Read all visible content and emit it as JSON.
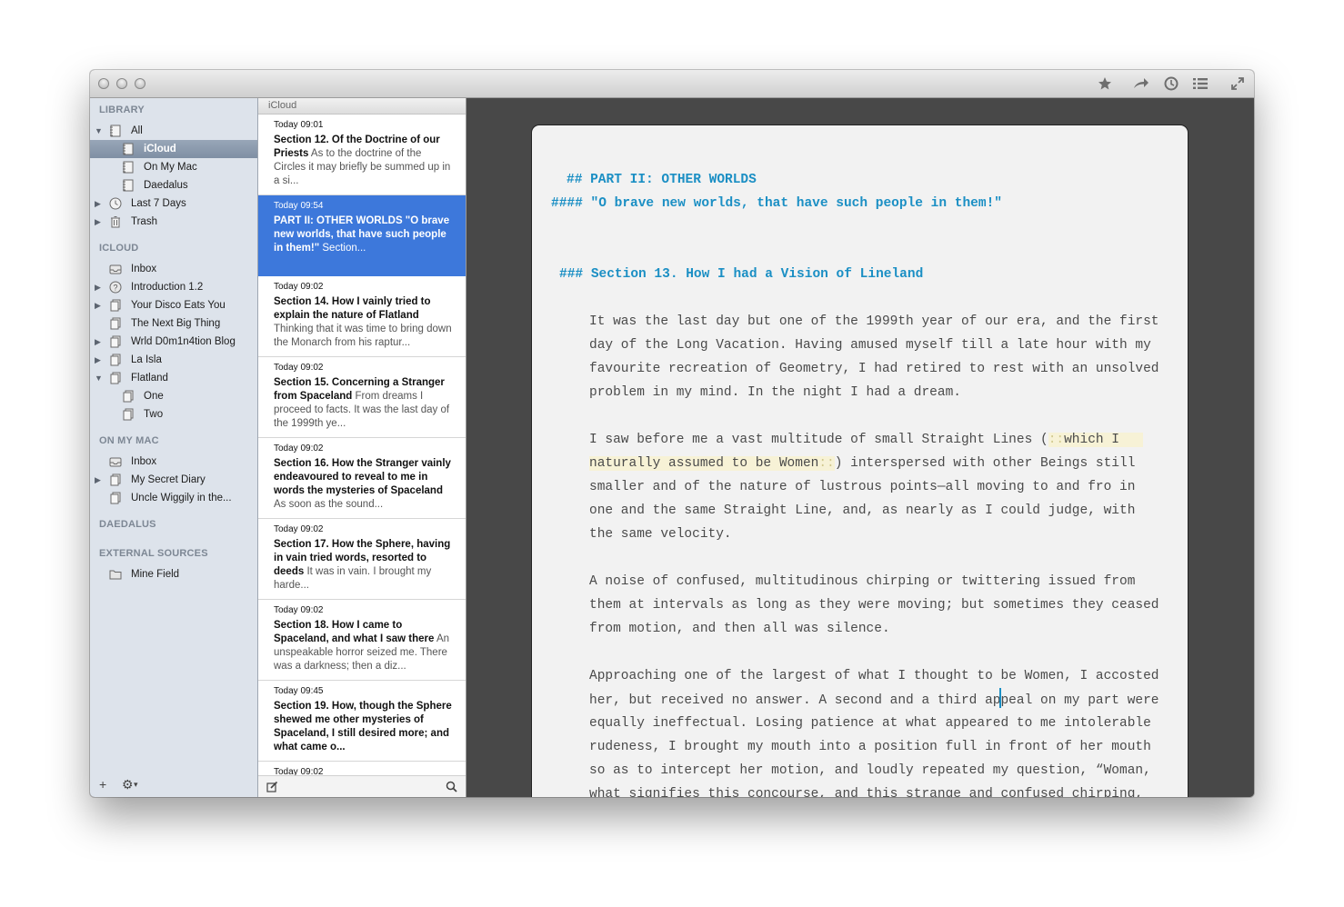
{
  "sidebar": {
    "library_header": "LIBRARY",
    "library": [
      {
        "label": "All",
        "disclosure": "open",
        "icon": "notebook-icon"
      },
      {
        "label": "iCloud",
        "icon": "notebook-icon",
        "selected": true
      },
      {
        "label": "On My Mac",
        "icon": "notebook-icon"
      },
      {
        "label": "Daedalus",
        "icon": "notebook-icon"
      },
      {
        "label": "Last 7 Days",
        "disclosure": "closed",
        "icon": "clock-icon"
      },
      {
        "label": "Trash",
        "disclosure": "closed",
        "icon": "trash-icon"
      }
    ],
    "icloud_header": "ICLOUD",
    "icloud": [
      {
        "label": "Inbox",
        "icon": "inbox-icon"
      },
      {
        "label": "Introduction 1.2",
        "disclosure": "closed",
        "icon": "help-icon"
      },
      {
        "label": "Your Disco Eats You",
        "disclosure": "closed",
        "icon": "stack-icon"
      },
      {
        "label": "The Next Big Thing",
        "icon": "stack-icon"
      },
      {
        "label": "Wrld D0m1n4tion Blog",
        "disclosure": "closed",
        "icon": "stack-icon"
      },
      {
        "label": "La Isla",
        "disclosure": "closed",
        "icon": "stack-icon"
      },
      {
        "label": "Flatland",
        "disclosure": "open",
        "icon": "stack-icon"
      },
      {
        "label": "One",
        "icon": "stack-icon"
      },
      {
        "label": "Two",
        "icon": "stack-icon"
      }
    ],
    "mac_header": "ON MY MAC",
    "mac": [
      {
        "label": "Inbox",
        "icon": "inbox-icon"
      },
      {
        "label": "My Secret Diary",
        "disclosure": "closed",
        "icon": "stack-icon"
      },
      {
        "label": "Uncle Wiggily in the...",
        "icon": "stack-icon"
      }
    ],
    "daedalus_header": "DAEDALUS",
    "external_header": "EXTERNAL SOURCES",
    "external": [
      {
        "label": "Mine Field",
        "icon": "folder-icon"
      }
    ],
    "add_button": "+",
    "gear_button": "⚙"
  },
  "notelist": {
    "header": "iCloud",
    "notes": [
      {
        "date": "Today 09:01",
        "title": "Section 12. Of the Doctrine of our Priests",
        "excerpt": "As to the doctrine of the Circles it may briefly be summed up in a si..."
      },
      {
        "date": "Today 09:54",
        "title": "PART II: OTHER WORLDS \"O brave new worlds, that have such people in them!\"",
        "excerpt": "Section...",
        "selected": true
      },
      {
        "date": "Today 09:02",
        "title": "Section 14. How I vainly tried to explain the nature of Flatland",
        "excerpt": "Thinking that it was time to bring down the Monarch from his raptur..."
      },
      {
        "date": "Today 09:02",
        "title": "Section 15. Concerning a Stranger from Spaceland",
        "excerpt": "From dreams I proceed to facts. It was the last day of the 1999th ye..."
      },
      {
        "date": "Today 09:02",
        "title": "Section 16. How the Stranger vainly endeavoured to reveal to me in words the mysteries of Spaceland",
        "excerpt": "As soon as the sound..."
      },
      {
        "date": "Today 09:02",
        "title": "Section 17. How the Sphere, having in vain tried words, resorted to deeds",
        "excerpt": "It was in vain. I brought my harde..."
      },
      {
        "date": "Today 09:02",
        "title": "Section 18. How I came to Spaceland, and what I saw there",
        "excerpt": "An unspeakable horror seized me. There was a darkness; then a diz..."
      },
      {
        "date": "Today 09:45",
        "title": "Section 19. How, though the Sphere shewed me other mysteries of Spaceland, I still desired more; and what came o...",
        "excerpt": ""
      },
      {
        "date": "Today 09:02",
        "title": "",
        "excerpt": ""
      }
    ]
  },
  "editor": {
    "h2_marker": "##",
    "h2_text": "PART II: OTHER WORLDS",
    "h4_marker": "####",
    "h4_text": "\"O brave new worlds, that have such people in them!\"",
    "h3_marker": "###",
    "h3_text": "Section 13. How I had a Vision of Lineland",
    "p1": [
      "It was the last day but one of the 1999th year of our era, and the first",
      "day of the Long Vacation. Having amused myself till a late hour with my",
      "favourite recreation of Geometry, I had retired to rest with an unsolved",
      "problem in my mind. In the night I had a dream."
    ],
    "p2_l1_a": "I saw before me a vast multitude of small Straight Lines (",
    "p2_l1_mark": "::",
    "p2_l1_b": "which I",
    "p2_l2_a": "naturally assumed to be Women",
    "p2_l2_mark": "::",
    "p2_l2_b": ") interspersed with other Beings still",
    "p2_rest": [
      "smaller and of the nature of lustrous points—all moving to and fro in",
      "one and the same Straight Line, and, as nearly as I could judge, with",
      "the same velocity."
    ],
    "p3": [
      "A noise of confused, multitudinous chirping or twittering issued from",
      "them at intervals as long as they were moving; but sometimes they ceased",
      "from motion, and then all was silence."
    ],
    "p4_l1": "Approaching one of the largest of what I thought to be Women, I accosted",
    "p4_l2_a": "her, but received no answer. A second and a third ap",
    "p4_l2_b": "peal on my part were",
    "p4_rest": [
      "equally ineffectual. Losing patience at what appeared to me intolerable",
      "rudeness, I brought my mouth into a position full in front of her mouth",
      "so as to intercept her motion, and loudly repeated my question, “Woman,",
      "what signifies this concourse, and this strange and confused chirping,"
    ]
  },
  "colors": {
    "heading_blue": "#1b8fc4",
    "selection_blue": "#3d78db",
    "editor_background": "#484848",
    "highlight": "#f7f2d6"
  }
}
